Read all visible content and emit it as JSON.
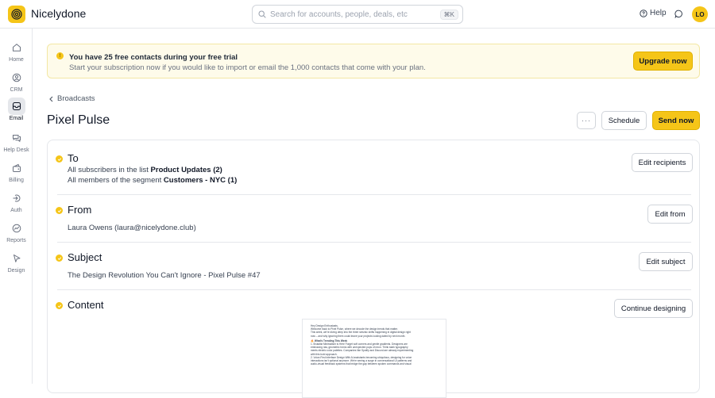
{
  "app": {
    "name": "Nicelydone",
    "avatar_initials": "LO"
  },
  "search": {
    "placeholder": "Search for accounts, people, deals, etc",
    "shortcut": "⌘K"
  },
  "header": {
    "help_label": "Help"
  },
  "sidebar": {
    "items": [
      {
        "label": "Home",
        "icon": "home-icon",
        "active": false
      },
      {
        "label": "CRM",
        "icon": "crm-icon",
        "active": false
      },
      {
        "label": "Email",
        "icon": "email-icon",
        "active": true
      },
      {
        "label": "Help Desk",
        "icon": "help-desk-icon",
        "active": false
      },
      {
        "label": "Billing",
        "icon": "billing-icon",
        "active": false
      },
      {
        "label": "Auth",
        "icon": "auth-icon",
        "active": false
      },
      {
        "label": "Reports",
        "icon": "reports-icon",
        "active": false
      },
      {
        "label": "Design",
        "icon": "design-icon",
        "active": false
      }
    ]
  },
  "banner": {
    "title": "You have 25 free contacts during your free trial",
    "text": "Start your subscription now if you would like to import or email the 1,000 contacts that come with your plan.",
    "button": "Upgrade now"
  },
  "page": {
    "breadcrumb": "Broadcasts",
    "title": "Pixel Pulse",
    "more_label": "···",
    "schedule_label": "Schedule",
    "send_label": "Send now"
  },
  "sections": {
    "to": {
      "title": "To",
      "line1_prefix": "All subscribers in the list",
      "line1_bold": "Product Updates (2)",
      "line2_prefix": "All members of the segment",
      "line2_bold": "Customers - NYC (1)",
      "button": "Edit recipients"
    },
    "from": {
      "title": "From",
      "value": "Laura Owens (laura@nicelydone.club)",
      "button": "Edit from"
    },
    "subject": {
      "title": "Subject",
      "value": "The Design Revolution You Can't Ignore - Pixel Pulse #47",
      "button": "Edit subject"
    },
    "content": {
      "title": "Content",
      "button": "Continue designing"
    }
  },
  "preview": {
    "lines": [
      "Hey Design Enthusiasts,",
      "Welcome back to Pixel Pulse, where we decode the design trends that matter.",
      "This week, we're diving deep into the three seismic shifts happening in digital design right",
      "now – and why ignoring them could leave your projects looking dated by next month."
    ],
    "heading": "🔥 What's Trending This Week",
    "body": [
      "1. Brutalist Minimalism is Here Forget soft corners and gentle gradients. Designers are",
      "embracing raw, geometric forms with unexpected pops of neon. Think stark typography",
      "meets electric color palettes. Companies like Spotify and Discord are already experimenting",
      "with this bold approach.",
      "2. Voice-First Interface Design With AI assistants becoming ubiquitous, designing for voice",
      "interactions isn't optional anymore. We're seeing a surge in conversational UI patterns and",
      "audio-visual feedback systems that bridge the gap between spoken commands and visual"
    ]
  },
  "colors": {
    "accent": "#f5c518",
    "banner_bg": "#fefbea",
    "border": "#e5e7eb"
  }
}
